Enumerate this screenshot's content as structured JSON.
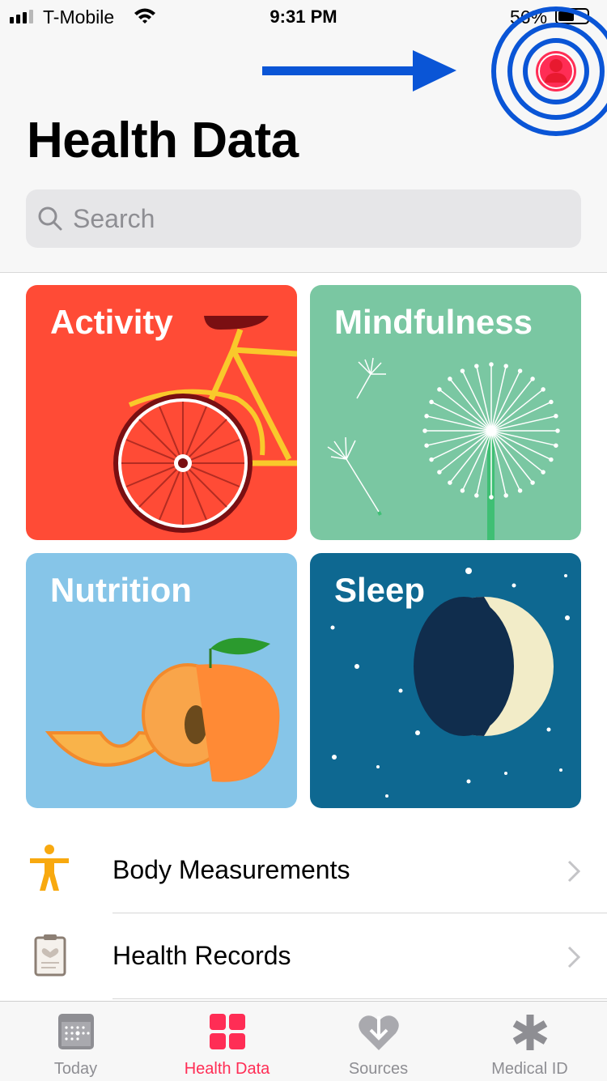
{
  "status_bar": {
    "carrier": "T-Mobile",
    "time": "9:31 PM",
    "battery_percent": "56%",
    "battery_level": 0.56
  },
  "header": {
    "title": "Health Data",
    "profile_icon": "profile-icon",
    "annotation_arrow_color": "#0a55d6"
  },
  "search": {
    "placeholder": "Search"
  },
  "categories": [
    {
      "label": "Activity",
      "color": "#ff4b36"
    },
    {
      "label": "Mindfulness",
      "color": "#7ac7a2"
    },
    {
      "label": "Nutrition",
      "color": "#86c5e8"
    },
    {
      "label": "Sleep",
      "color": "#0e6891"
    }
  ],
  "list": [
    {
      "label": "Body Measurements",
      "icon": "body-figure-icon"
    },
    {
      "label": "Health Records",
      "icon": "clipboard-icon"
    }
  ],
  "tab_bar": {
    "tabs": [
      {
        "label": "Today",
        "icon": "calendar-icon",
        "active": false
      },
      {
        "label": "Health Data",
        "icon": "grid-icon",
        "active": true
      },
      {
        "label": "Sources",
        "icon": "heart-download-icon",
        "active": false
      },
      {
        "label": "Medical ID",
        "icon": "asterisk-icon",
        "active": false
      }
    ],
    "active_color": "#ff2d55"
  }
}
